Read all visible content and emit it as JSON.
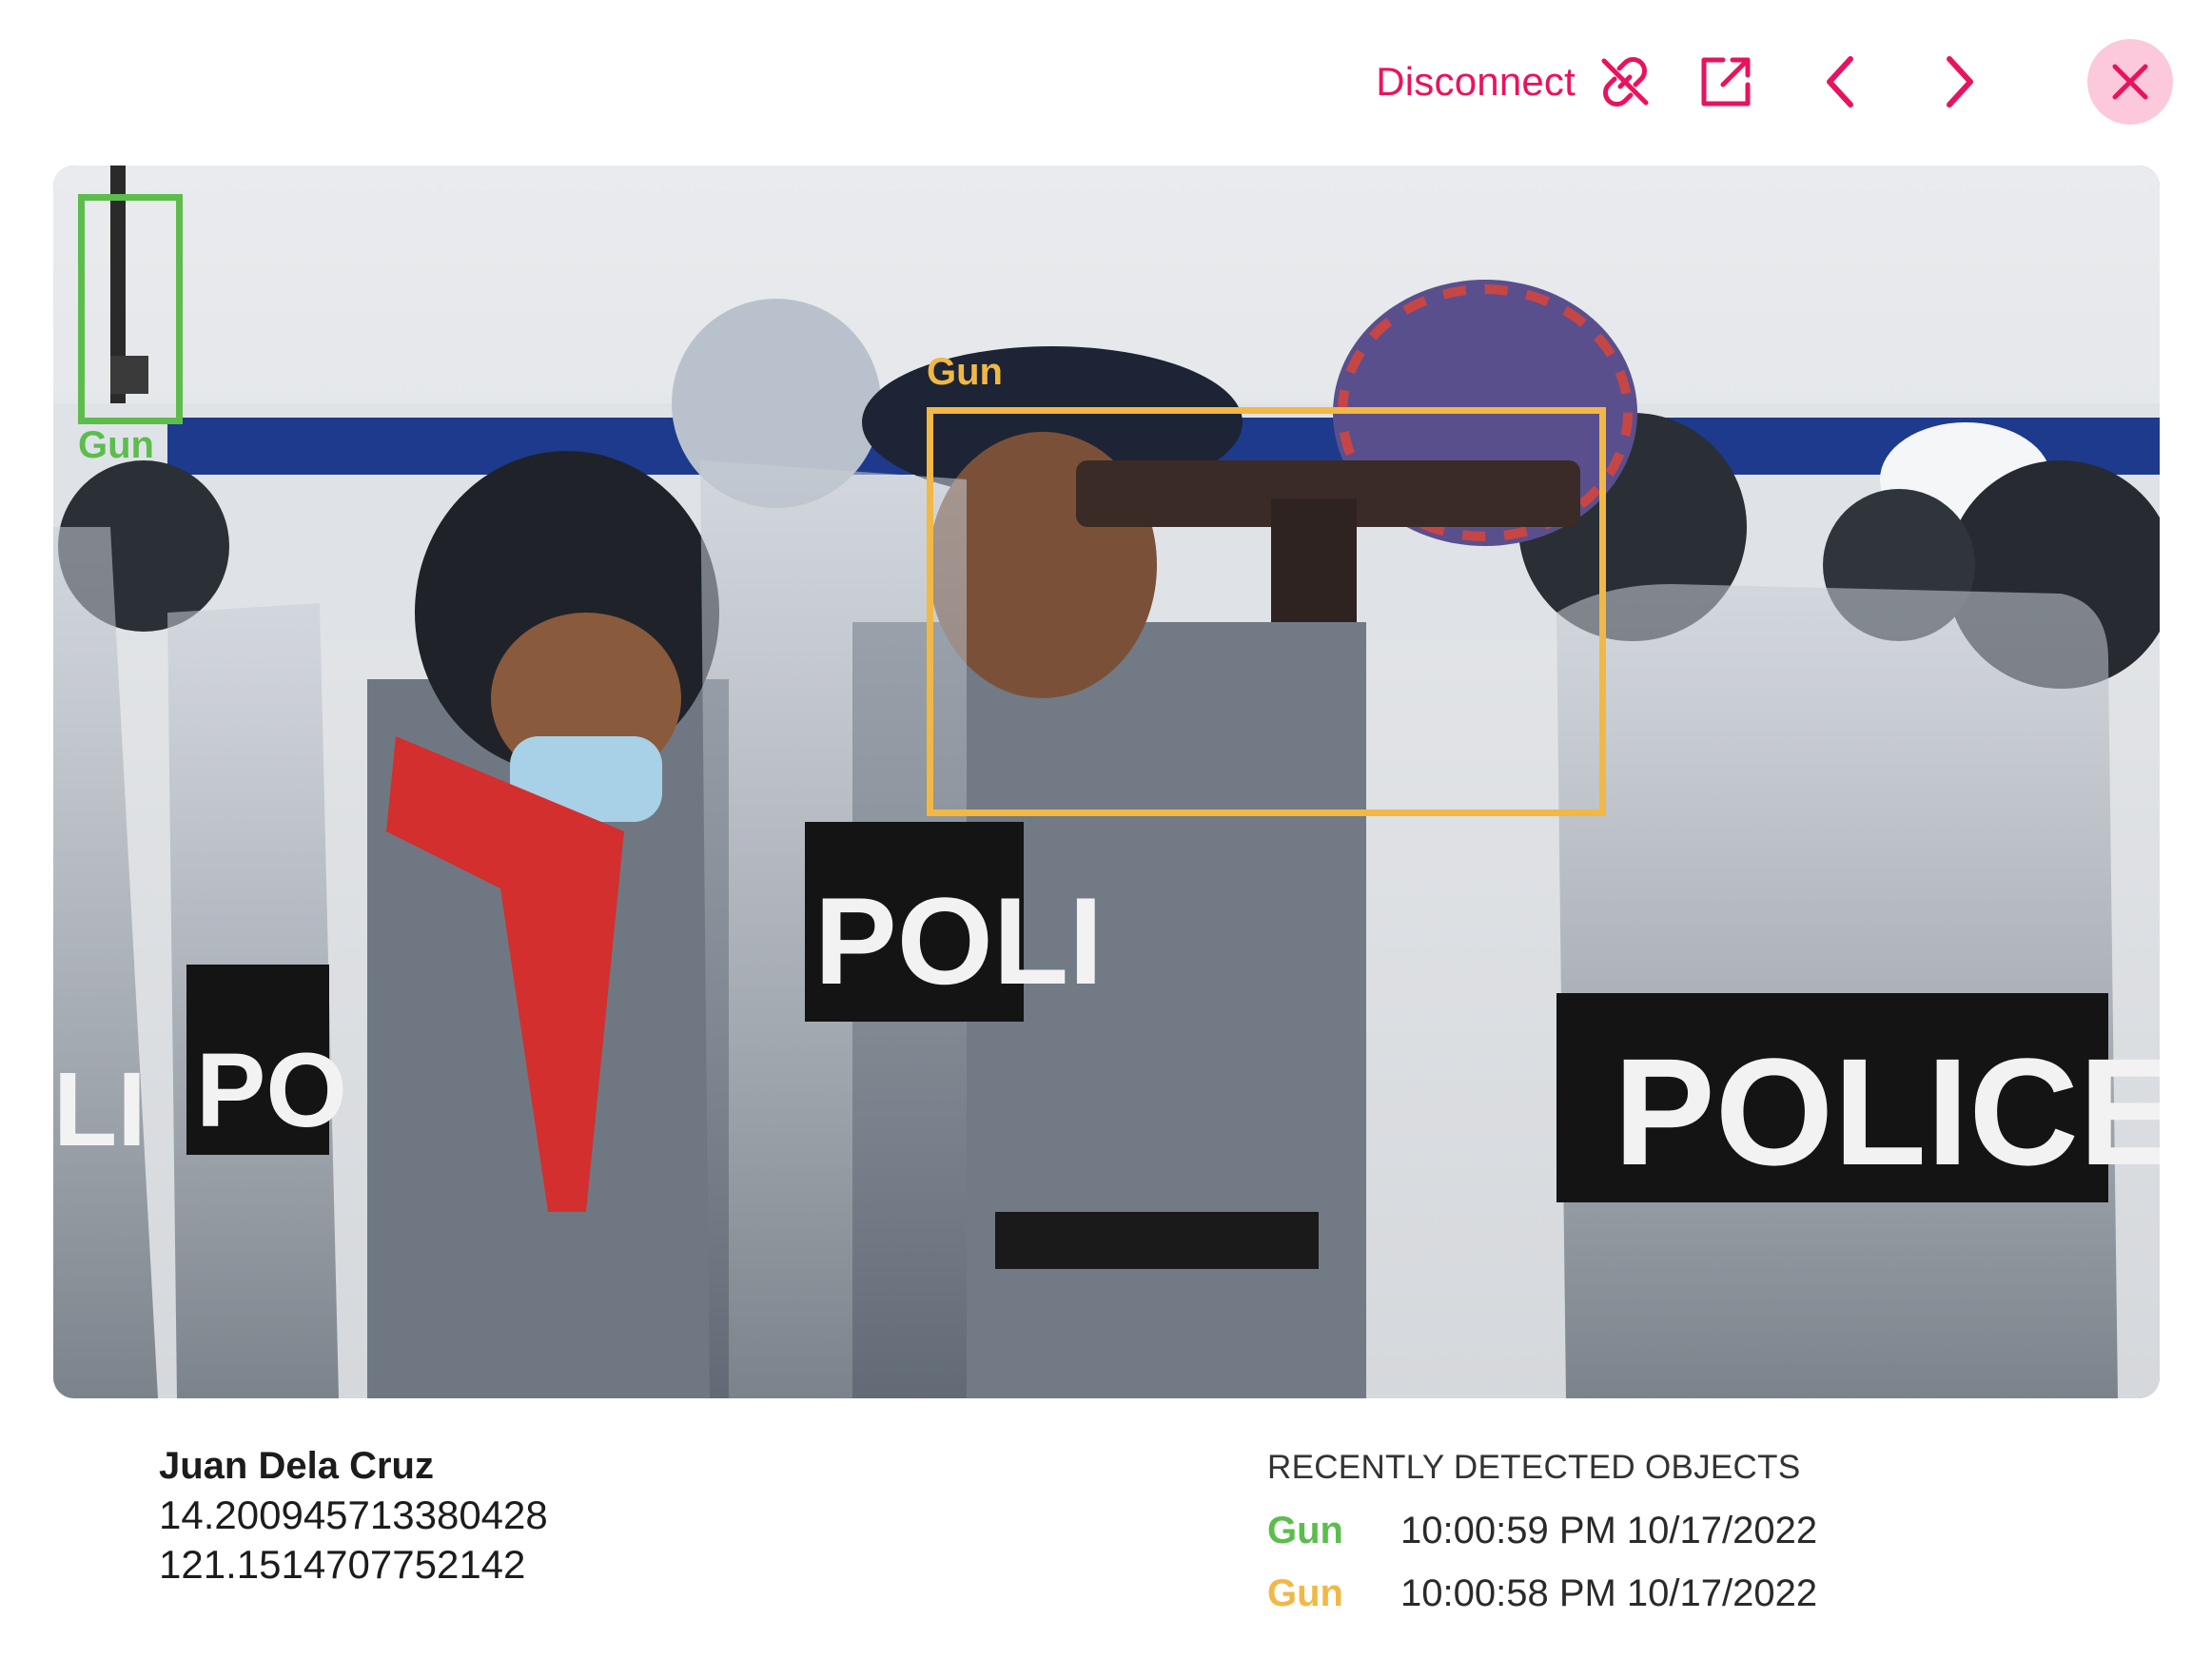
{
  "toolbar": {
    "disconnect_label": "Disconnect",
    "accent_color": "#e8135f",
    "close_bg_color": "#fbc9db"
  },
  "camera": {
    "detections_overlay": [
      {
        "label": "Gun",
        "color": "#5cbd4d"
      },
      {
        "label": "Gun",
        "color": "#f1b845"
      }
    ]
  },
  "person": {
    "name": "Juan Dela Cruz",
    "latitude": "14.200945713380428",
    "longitude": "121.1514707752142"
  },
  "recent": {
    "title": "RECENTLY DETECTED OBJECTS",
    "items": [
      {
        "object": "Gun",
        "time": "10:00:59 PM 10/17/2022",
        "color": "#5cbd4d"
      },
      {
        "object": "Gun",
        "time": "10:00:58 PM 10/17/2022",
        "color": "#f1b845"
      }
    ]
  }
}
